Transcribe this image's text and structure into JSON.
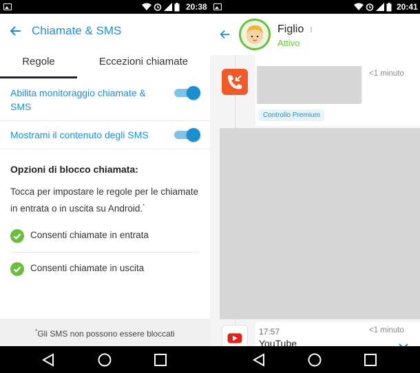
{
  "left": {
    "status": {
      "time": "20:38"
    },
    "appbar": {
      "title": "Chiamate & SMS"
    },
    "tabs": [
      {
        "label": "Regole",
        "active": true
      },
      {
        "label": "Eccezioni chiamate",
        "active": false
      }
    ],
    "settings": [
      {
        "label": "Abilita monitoraggio chiamate & SMS",
        "enabled": true
      },
      {
        "label": "Mostrami il contenuto degli SMS",
        "enabled": true
      }
    ],
    "blocking": {
      "title": "Opzioni di blocco chiamata:",
      "description": "Tocca per impostare le regole per le chiamate in entrata o in uscita su Android.",
      "description_mark": "*",
      "options": [
        {
          "label": "Consenti chiamate in entrata",
          "checked": true
        },
        {
          "label": "Consenti chiamate in uscita",
          "checked": true
        }
      ]
    },
    "footer": {
      "mark": "*",
      "text": "Gli SMS non possono essere bloccati"
    }
  },
  "right": {
    "status": {
      "time": "20:41"
    },
    "child": {
      "name": "Figlio",
      "status": "Attivo"
    },
    "feed": {
      "call_item": {
        "time_ago": "<1 minuto",
        "badge": "Controllo Premium"
      },
      "youtube_item": {
        "time": "17:57",
        "time_ago": "<1 minuto",
        "app_name": "YouTube"
      }
    }
  },
  "colors": {
    "accent": "#1a8fcf",
    "green": "#6abf3c",
    "orange": "#f05a28",
    "youtube_red": "#e62117"
  }
}
